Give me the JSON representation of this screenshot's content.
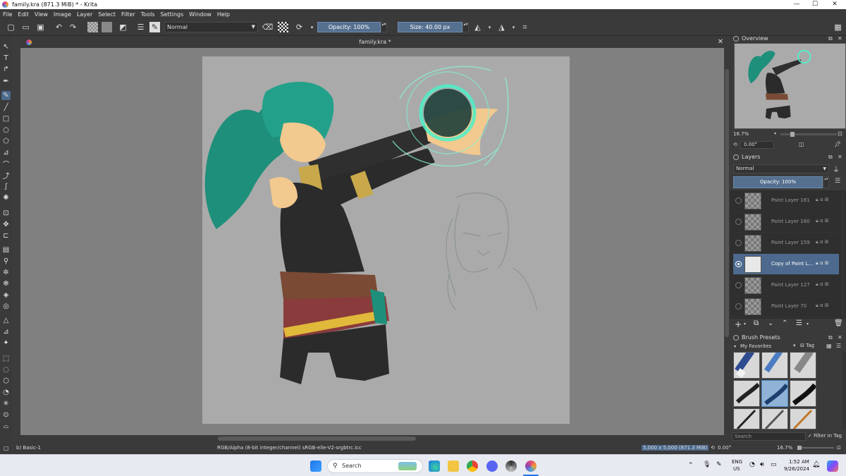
{
  "window": {
    "title": "family.kra (871.3 MiB)  * - Krita",
    "min": "—",
    "max": "☐",
    "close": "✕"
  },
  "menu": [
    "File",
    "Edit",
    "View",
    "Image",
    "Layer",
    "Select",
    "Filter",
    "Tools",
    "Settings",
    "Window",
    "Help"
  ],
  "toolbar": {
    "blend_mode": "Normal",
    "opacity_label": "Opacity: 100%",
    "size_label": "Size: 40.00 px"
  },
  "document": {
    "tab_title": "family.kra *"
  },
  "overview": {
    "title": "Overview",
    "zoom": "16.7%",
    "rotation": "0.00°"
  },
  "layers": {
    "title": "Layers",
    "blend_mode": "Normal",
    "opacity_label": "Opacity:  100%",
    "items": [
      {
        "name": "Paint Layer 161",
        "active": false
      },
      {
        "name": "Paint Layer 160",
        "active": false
      },
      {
        "name": "Paint Layer 159",
        "active": false
      },
      {
        "name": "Copy of Paint L...",
        "active": true
      },
      {
        "name": "Paint Layer 127",
        "active": false
      },
      {
        "name": "Paint Layer 70",
        "active": false
      }
    ]
  },
  "brush_presets": {
    "title": "Brush Presets",
    "tag": "My Favorites",
    "tag_button": "Tag",
    "search_placeholder": "Search",
    "filter_in_tag": "Filter in Tag"
  },
  "status": {
    "brush": "b) Basic-1",
    "color_profile": "RGB/Alpha (8-bit integer/channel)  sRGB-elle-V2-srgbtrc.icc",
    "image_size": "5,000 x 5,000 (871.3 MiB)",
    "rotation": "0.00°",
    "zoom": "16.7%"
  },
  "taskbar": {
    "search_label": "Search",
    "lang_top": "ENG",
    "lang_bottom": "US",
    "time": "1:52 AM",
    "date": "9/26/2024"
  }
}
